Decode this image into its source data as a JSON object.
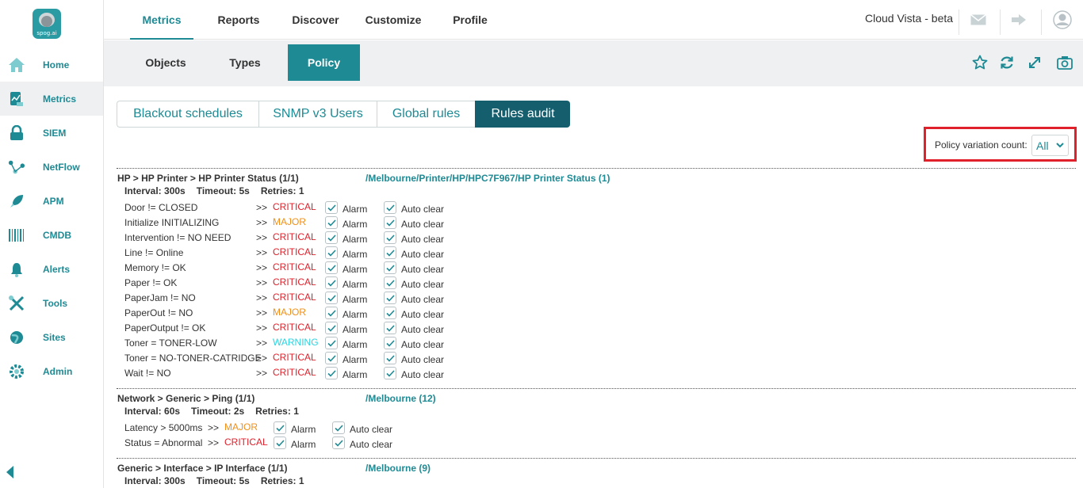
{
  "app": {
    "logo_text": "spog.ai",
    "brand": "Cloud Vista - beta"
  },
  "colors": {
    "accent": "#1e8a94",
    "dark_accent": "#155e6e",
    "critical": "#e0202a",
    "major": "#f0901a",
    "warning": "#2ed3e0",
    "highlight_box": "#e0202a"
  },
  "sidebar": {
    "items": [
      {
        "label": "Home",
        "icon": "home-icon"
      },
      {
        "label": "Metrics",
        "icon": "chart-doc-icon",
        "active": true
      },
      {
        "label": "SIEM",
        "icon": "lock-icon"
      },
      {
        "label": "NetFlow",
        "icon": "network-icon"
      },
      {
        "label": "APM",
        "icon": "rocket-icon"
      },
      {
        "label": "CMDB",
        "icon": "barcode-icon"
      },
      {
        "label": "Alerts",
        "icon": "bell-icon"
      },
      {
        "label": "Tools",
        "icon": "tools-icon"
      },
      {
        "label": "Sites",
        "icon": "globe-icon"
      },
      {
        "label": "Admin",
        "icon": "gear-icon"
      }
    ]
  },
  "topnav": {
    "tabs": [
      {
        "label": "Metrics",
        "active": true
      },
      {
        "label": "Reports"
      },
      {
        "label": "Discover"
      },
      {
        "label": "Customize"
      },
      {
        "label": "Profile"
      }
    ]
  },
  "subnav": {
    "tabs": [
      {
        "label": "Objects"
      },
      {
        "label": "Types"
      },
      {
        "label": "Policy",
        "active": true
      }
    ]
  },
  "policy_tabs": [
    {
      "label": "Blackout schedules"
    },
    {
      "label": "SNMP v3 Users"
    },
    {
      "label": "Global rules"
    },
    {
      "label": "Rules audit",
      "active": true
    }
  ],
  "variation": {
    "label": "Policy variation count:",
    "value": "All"
  },
  "groups": [
    {
      "title": "HP > HP Printer > HP Printer Status (1/1)",
      "path": "/Melbourne/Printer/HP/HPC7F967/HP Printer Status (1)",
      "interval": "Interval: 300s",
      "timeout": "Timeout: 5s",
      "retries": "Retries: 1",
      "rules": [
        {
          "condition": "Door != CLOSED",
          "arrow": ">>",
          "severity": "CRITICAL",
          "alarm": "Alarm",
          "autoclear": "Auto clear"
        },
        {
          "condition": "Initialize INITIALIZING",
          "arrow": ">>",
          "severity": "MAJOR",
          "alarm": "Alarm",
          "autoclear": "Auto clear"
        },
        {
          "condition": "Intervention != NO NEED",
          "arrow": ">>",
          "severity": "CRITICAL",
          "alarm": "Alarm",
          "autoclear": "Auto clear"
        },
        {
          "condition": "Line != Online",
          "arrow": ">>",
          "severity": "CRITICAL",
          "alarm": "Alarm",
          "autoclear": "Auto clear"
        },
        {
          "condition": "Memory != OK",
          "arrow": ">>",
          "severity": "CRITICAL",
          "alarm": "Alarm",
          "autoclear": "Auto clear"
        },
        {
          "condition": "Paper != OK",
          "arrow": ">>",
          "severity": "CRITICAL",
          "alarm": "Alarm",
          "autoclear": "Auto clear"
        },
        {
          "condition": "PaperJam != NO",
          "arrow": ">>",
          "severity": "CRITICAL",
          "alarm": "Alarm",
          "autoclear": "Auto clear"
        },
        {
          "condition": "PaperOut != NO",
          "arrow": ">>",
          "severity": "MAJOR",
          "alarm": "Alarm",
          "autoclear": "Auto clear"
        },
        {
          "condition": "PaperOutput != OK",
          "arrow": ">>",
          "severity": "CRITICAL",
          "alarm": "Alarm",
          "autoclear": "Auto clear"
        },
        {
          "condition": "Toner = TONER-LOW",
          "arrow": ">>",
          "severity": "WARNING",
          "alarm": "Alarm",
          "autoclear": "Auto clear"
        },
        {
          "condition": "Toner = NO-TONER-CATRIDGE",
          "arrow": ">>",
          "severity": "CRITICAL",
          "alarm": "Alarm",
          "autoclear": "Auto clear"
        },
        {
          "condition": "Wait != NO",
          "arrow": ">>",
          "severity": "CRITICAL",
          "alarm": "Alarm",
          "autoclear": "Auto clear"
        }
      ]
    },
    {
      "title": "Network > Generic > Ping (1/1)",
      "path": "/Melbourne (12)",
      "interval": "Interval: 60s",
      "timeout": "Timeout: 2s",
      "retries": "Retries: 1",
      "rules": [
        {
          "condition": "Latency > 5000ms",
          "arrow": ">>",
          "severity": "MAJOR",
          "alarm": "Alarm",
          "autoclear": "Auto clear"
        },
        {
          "condition": "Status = Abnormal",
          "arrow": ">>",
          "severity": "CRITICAL",
          "alarm": "Alarm",
          "autoclear": "Auto clear"
        }
      ]
    },
    {
      "title": "Generic > Interface > IP Interface (1/1)",
      "path": "/Melbourne (9)",
      "interval": "Interval: 300s",
      "timeout": "Timeout: 5s",
      "retries": "Retries: 1",
      "rules": []
    }
  ]
}
